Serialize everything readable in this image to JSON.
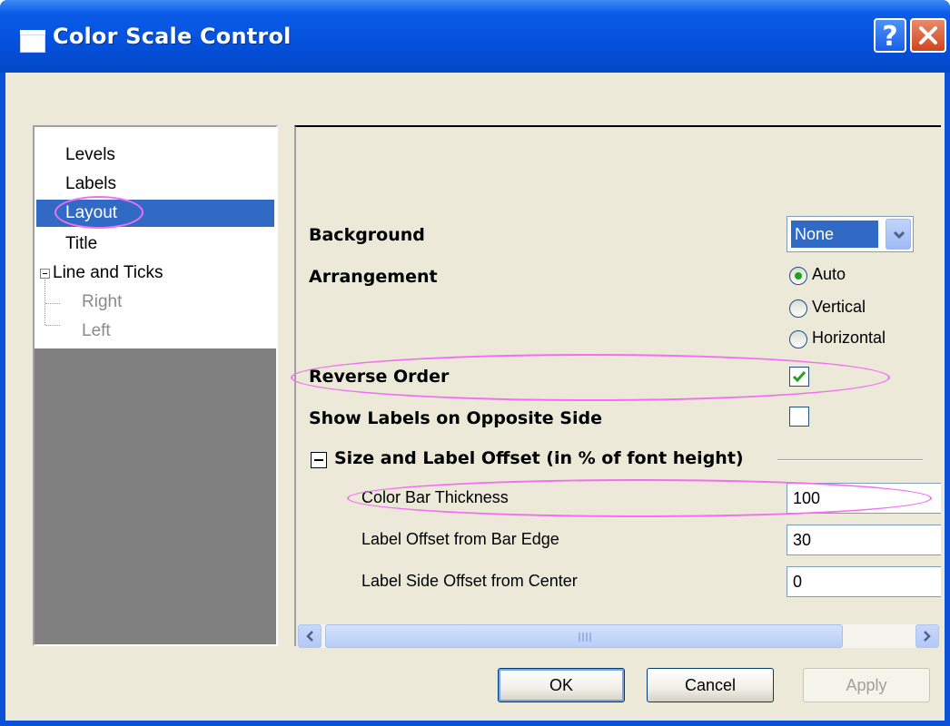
{
  "window": {
    "title": "Color Scale Control"
  },
  "tree": {
    "items": [
      {
        "label": "Levels"
      },
      {
        "label": "Labels"
      },
      {
        "label": "Layout"
      },
      {
        "label": "Title"
      },
      {
        "label": "Line and Ticks"
      },
      {
        "label": "Right"
      },
      {
        "label": "Left"
      }
    ],
    "selected": "Layout"
  },
  "layout": {
    "background_label": "Background",
    "background_value": "None",
    "arrangement_label": "Arrangement",
    "arrangement_options": [
      "Auto",
      "Vertical",
      "Horizontal"
    ],
    "arrangement_selected": "Auto",
    "reverse_order_label": "Reverse Order",
    "reverse_order_checked": true,
    "show_labels_opposite_label": "Show Labels on Opposite Side",
    "show_labels_opposite_checked": false,
    "section_title": "Size and Label Offset (in % of font height)",
    "fields": [
      {
        "label": "Color Bar Thickness",
        "value": "100"
      },
      {
        "label": "Label Offset from Bar Edge",
        "value": "30"
      },
      {
        "label": "Label Side Offset from Center",
        "value": "0"
      }
    ],
    "scrollbar_grip": "III"
  },
  "buttons": {
    "ok": "OK",
    "cancel": "Cancel",
    "apply": "Apply"
  },
  "colors": {
    "titlebar": "#0552de",
    "selection": "#316ac5",
    "highlight_ellipse": "#f26ef2",
    "dialog_bg": "#ece9d8"
  }
}
